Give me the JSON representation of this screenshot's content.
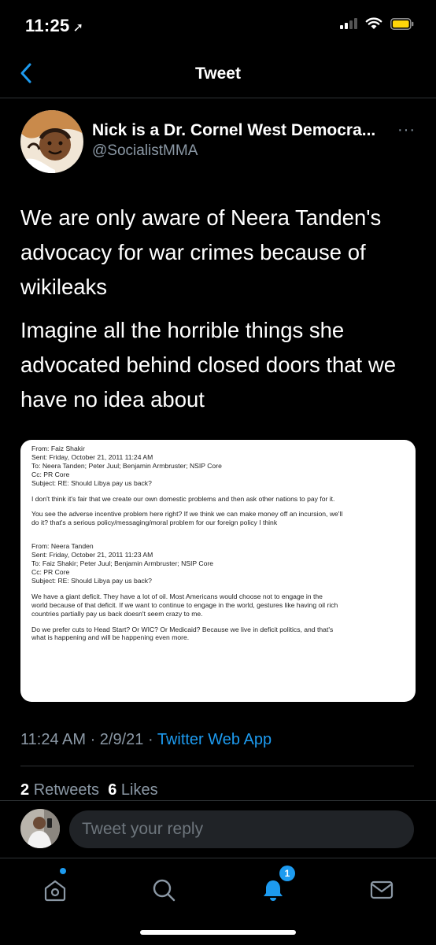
{
  "status": {
    "time": "11:25"
  },
  "nav": {
    "title": "Tweet"
  },
  "author": {
    "name": "Nick is a Dr. Cornel West Democra...",
    "handle": "@SocialistMMA",
    "more": "···"
  },
  "tweet": {
    "paragraphs": [
      "We are only aware of Neera Tanden's advocacy for war crimes because of wikileaks",
      "Imagine all the horrible things she advocated behind closed doors that we have no idea about"
    ],
    "timestamp": "11:24 AM · 2/9/21 · ",
    "app": "Twitter Web App",
    "retweets_count": "2",
    "retweets_label": "Retweets",
    "likes_count": "6",
    "likes_label": "Likes"
  },
  "email_image": {
    "lines": [
      "From: Faiz Shakir",
      "Sent: Friday, October 21, 2011 11:24 AM",
      "To: Neera Tanden; Peter Juul; Benjamin Armbruster; NSIP Core",
      "Cc: PR Core",
      "Subject: RE: Should Libya pay us back?",
      "I don't think it's fair that we create our own domestic problems and then ask other nations to pay for it.",
      "You see the adverse incentive problem here right? If we think we can make money off an incursion, we'll",
      "do it? that's a serious policy/messaging/moral problem for our foreign policy I think",
      "From: Neera Tanden",
      "Sent: Friday, October 21, 2011 11:23 AM",
      "To: Faiz Shakir; Peter Juul; Benjamin Armbruster; NSIP Core",
      "Cc: PR Core",
      "Subject: RE: Should Libya pay us back?",
      "We have a giant deficit.  They have a lot of oil.  Most Americans would choose not to engage in the",
      "world because of that deficit.  If we want to continue to engage in the world, gestures like having oil rich",
      "countries partially pay us back doesn't seem crazy to me.",
      "Do we prefer cuts to Head Start? Or WIC? Or Medicaid?  Because we live in deficit politics, and that's",
      "what is happening and will be happening even more."
    ]
  },
  "reply": {
    "placeholder": "Tweet your reply"
  },
  "tabbar": {
    "items": [
      "home-icon",
      "search-icon",
      "notifications-icon",
      "messages-icon"
    ],
    "notification_badge": "1"
  },
  "colors": {
    "accent": "#1d9bf0",
    "muted": "#8b98a5",
    "reply_bg": "#202327",
    "divider": "#2f3336"
  }
}
